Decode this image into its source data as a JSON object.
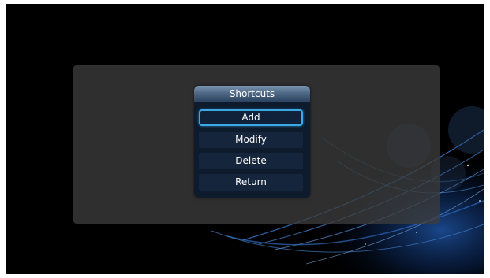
{
  "dialog": {
    "title": "Shortcuts",
    "items": [
      {
        "label": "Add",
        "selected": true
      },
      {
        "label": "Modify",
        "selected": false
      },
      {
        "label": "Delete",
        "selected": false
      },
      {
        "label": "Return",
        "selected": false
      }
    ]
  },
  "colors": {
    "background": "#000000",
    "panel": "#3c3c3c",
    "dialog": "#0d1b2d",
    "item": "#14253c",
    "focus": "#3ea8e6",
    "wave": "#3a7fd6"
  }
}
